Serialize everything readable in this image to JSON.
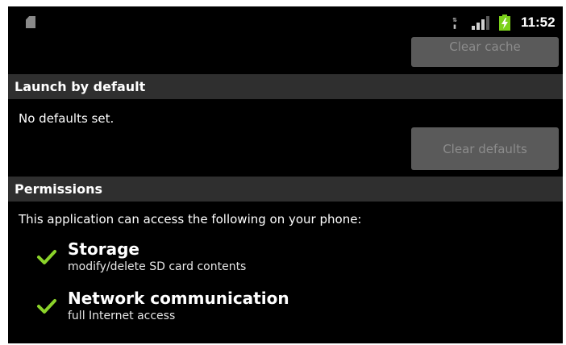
{
  "status_bar": {
    "time": "11:52",
    "icons": [
      "sd-card-icon",
      "data-transfer-icon",
      "signal-strength-icon",
      "battery-charging-icon"
    ],
    "battery_color": "#7cd11c"
  },
  "cache": {
    "clear_cache_label": "Clear cache"
  },
  "launch_by_default": {
    "header": "Launch by default",
    "message": "No defaults set.",
    "clear_defaults_label": "Clear defaults"
  },
  "permissions": {
    "header": "Permissions",
    "intro": "This application can access the following on your phone:",
    "items": [
      {
        "title": "Storage",
        "description": "modify/delete SD card contents",
        "icon": "check-icon"
      },
      {
        "title": "Network communication",
        "description": "full Internet access",
        "icon": "check-icon"
      }
    ],
    "check_color": "#8bd32a"
  },
  "colors": {
    "screen_bg": "#000000",
    "section_header_bg": "#2f2f2f",
    "disabled_button_bg": "#5a5a5a",
    "disabled_button_text": "#8c8c8c"
  }
}
